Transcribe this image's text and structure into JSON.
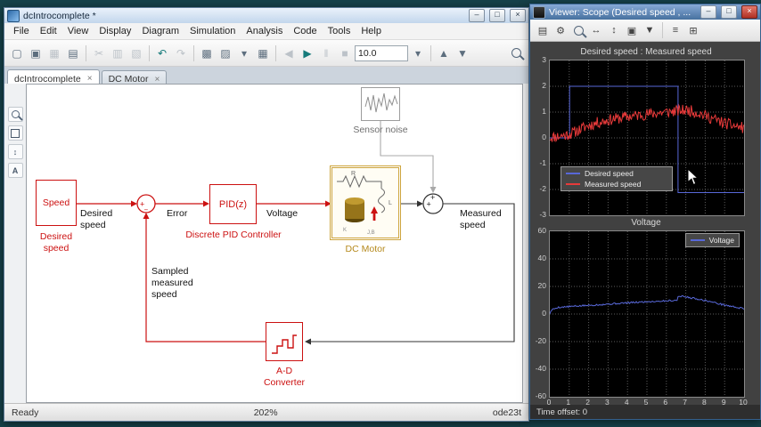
{
  "simulink": {
    "title": "dcIntrocomplete *",
    "window_buttons": {
      "minimize": "–",
      "maximize": "□",
      "close": "×"
    },
    "menu": [
      "File",
      "Edit",
      "View",
      "Display",
      "Diagram",
      "Simulation",
      "Analysis",
      "Code",
      "Tools",
      "Help"
    ],
    "toolbar": {
      "sim_time": "10.0",
      "items": [
        {
          "name": "new-model-icon",
          "glyph": "▢"
        },
        {
          "name": "open-model-icon",
          "glyph": "▣"
        },
        {
          "name": "save-icon",
          "glyph": "▦",
          "disabled": true
        },
        {
          "name": "print-icon",
          "glyph": "▤"
        },
        {
          "type": "sep"
        },
        {
          "name": "cut-icon",
          "glyph": "✂",
          "disabled": true
        },
        {
          "name": "copy-icon",
          "glyph": "▥",
          "disabled": true
        },
        {
          "name": "paste-icon",
          "glyph": "▧",
          "disabled": true
        },
        {
          "type": "sep"
        },
        {
          "name": "undo-icon",
          "glyph": "↶",
          "accent": true
        },
        {
          "name": "redo-icon",
          "glyph": "↷",
          "disabled": true
        },
        {
          "type": "sep"
        },
        {
          "name": "library-browser-icon",
          "glyph": "▩"
        },
        {
          "name": "model-config-icon",
          "glyph": "▨"
        },
        {
          "name": "library-dropdown-icon",
          "glyph": "▾"
        },
        {
          "name": "model-explorer-icon",
          "glyph": "▦"
        },
        {
          "type": "sep"
        },
        {
          "name": "step-back-icon",
          "glyph": "◀",
          "disabled": true
        },
        {
          "name": "run-icon",
          "glyph": "▶",
          "accent": true
        },
        {
          "name": "pause-icon",
          "glyph": "‖",
          "disabled": true
        },
        {
          "name": "stop-icon",
          "glyph": "■",
          "disabled": true
        },
        {
          "type": "field"
        },
        {
          "name": "sim-mode-dropdown-icon",
          "glyph": "▾"
        },
        {
          "type": "sep"
        },
        {
          "name": "build-icon",
          "glyph": "▲"
        },
        {
          "name": "more-tools-dropdown-icon",
          "glyph": "▼"
        },
        {
          "type": "spacer"
        },
        {
          "name": "search-icon",
          "type": "zoom"
        }
      ]
    },
    "tabs": [
      {
        "label": "dcIntrocomplete",
        "active": true
      },
      {
        "label": "DC Motor",
        "active": false
      }
    ],
    "tool_strip": [
      {
        "name": "zoom-icon",
        "type": "zoom"
      },
      {
        "name": "fit-to-view-icon",
        "type": "frame"
      },
      {
        "name": "pan-icon",
        "glyph": "↕"
      },
      {
        "name": "annotation-icon",
        "glyph": "A"
      }
    ],
    "status": {
      "ready": "Ready",
      "zoom": "202%",
      "solver": "ode23t"
    },
    "diagram": {
      "speed_block_text": "Speed",
      "speed_block_label": "Desired speed",
      "wire_label_desired": "Desired speed",
      "wire_label_error": "Error",
      "pid_block_text": "PID(z)",
      "pid_block_label": "Discrete PID Controller",
      "wire_label_voltage": "Voltage",
      "motor_block_label": "DC Motor",
      "motor_internals": {
        "r": "R",
        "l": "L",
        "k": "K",
        "jb": "J,B"
      },
      "noise_block_label": "Sensor noise",
      "wire_label_measured": "Measured speed",
      "feedback_label": "Sampled measured speed",
      "adc_block_label": "A-D Converter",
      "sum1_signs": {
        "a": "+",
        "b": "−"
      },
      "sum2_signs": {
        "a": "+",
        "b": "+"
      }
    }
  },
  "scope": {
    "title": "Viewer: Scope (Desired speed , ...",
    "window_buttons": {
      "minimize": "–",
      "maximize": "□",
      "close": "×"
    },
    "toolbar_items": [
      {
        "name": "print-icon",
        "glyph": "▤"
      },
      {
        "name": "scope-parameters-icon",
        "glyph": "⚙"
      },
      {
        "name": "zoom-icon",
        "type": "zoom"
      },
      {
        "name": "zoom-x-icon",
        "glyph": "↔"
      },
      {
        "name": "zoom-y-icon",
        "glyph": "↕"
      },
      {
        "name": "autoscale-icon",
        "glyph": "▣"
      },
      {
        "name": "save-axes-settings-icon",
        "glyph": "▼"
      },
      {
        "type": "sep"
      },
      {
        "name": "legends-toggle-icon",
        "glyph": "≡"
      },
      {
        "name": "signal-selector-icon",
        "glyph": "⊞",
        "accent": true
      }
    ],
    "footer": "Time offset: 0"
  },
  "chart_data": [
    {
      "type": "line",
      "title": "Desired speed : Measured speed",
      "xlabel": "",
      "ylabel": "",
      "xlim": [
        0,
        10
      ],
      "ylim": [
        -3,
        3
      ],
      "yticks": [
        -3,
        -2,
        -1,
        0,
        1,
        2,
        3
      ],
      "xticks": [
        0,
        1,
        2,
        3,
        4,
        5,
        6,
        7,
        8,
        9,
        10
      ],
      "grid": true,
      "legend": {
        "position": "lower-left",
        "entries": [
          {
            "label": "Desired speed",
            "color": "#5868d8"
          },
          {
            "label": "Measured speed",
            "color": "#e83a3a"
          }
        ]
      },
      "series": [
        {
          "name": "Desired speed",
          "color": "#5868d8",
          "points": [
            [
              0,
              0
            ],
            [
              1.02,
              0
            ],
            [
              1.02,
              2
            ],
            [
              6.6,
              2
            ],
            [
              6.6,
              -2.12
            ],
            [
              10,
              -2.12
            ]
          ]
        },
        {
          "name": "Measured speed",
          "color": "#e83a3a",
          "envelope": [
            [
              0,
              0.02
            ],
            [
              0.3,
              0.05
            ],
            [
              0.8,
              0.1
            ],
            [
              1.2,
              0.2
            ],
            [
              1.8,
              0.42
            ],
            [
              2.5,
              0.6
            ],
            [
              3.2,
              0.72
            ],
            [
              4,
              0.82
            ],
            [
              5,
              0.92
            ],
            [
              6,
              1.0
            ],
            [
              6.6,
              1.05
            ],
            [
              7.1,
              1.08
            ],
            [
              7.6,
              0.98
            ],
            [
              8.2,
              0.8
            ],
            [
              8.8,
              0.62
            ],
            [
              9.4,
              0.48
            ],
            [
              10,
              0.38
            ]
          ],
          "noise_amp": 0.22,
          "noise_seed": 11,
          "sample_step": 0.04
        }
      ]
    },
    {
      "type": "line",
      "title": "Voltage",
      "xlabel": "",
      "ylabel": "",
      "xlim": [
        0,
        10
      ],
      "ylim": [
        -60,
        60
      ],
      "yticks": [
        -60,
        -40,
        -20,
        0,
        20,
        40,
        60
      ],
      "xticks": [
        0,
        1,
        2,
        3,
        4,
        5,
        6,
        7,
        8,
        9,
        10
      ],
      "show_x_labels": true,
      "grid": true,
      "legend": {
        "position": "upper-right",
        "entries": [
          {
            "label": "Voltage",
            "color": "#5868d8"
          }
        ]
      },
      "series": [
        {
          "name": "Voltage",
          "color": "#5868d8",
          "envelope": [
            [
              0,
              0.5
            ],
            [
              0.1,
              3
            ],
            [
              0.4,
              4.8
            ],
            [
              1,
              5.4
            ],
            [
              2,
              6.3
            ],
            [
              3,
              7.2
            ],
            [
              4,
              8.1
            ],
            [
              5,
              8.9
            ],
            [
              6,
              9.6
            ],
            [
              6.55,
              10
            ],
            [
              6.62,
              13.2
            ],
            [
              7,
              12.4
            ],
            [
              7.6,
              11
            ],
            [
              8.2,
              9.2
            ],
            [
              9,
              6.5
            ],
            [
              10,
              3.8
            ]
          ],
          "noise_amp": 0.6,
          "noise_seed": 5,
          "sample_step": 0.05
        }
      ]
    }
  ]
}
